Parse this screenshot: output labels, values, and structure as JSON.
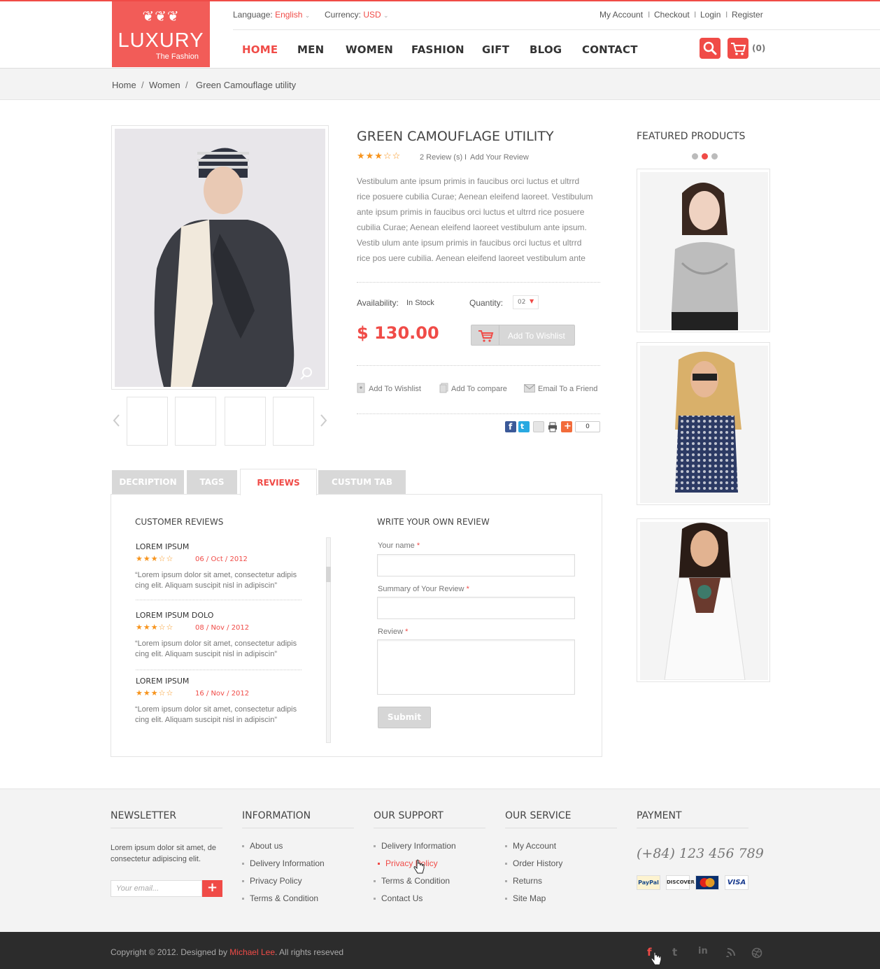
{
  "logo": {
    "brand": "LUXURY",
    "tagline": "The Fashion",
    "ornament": "❦❦❦"
  },
  "topbar": {
    "language_label": "Language:",
    "language_value": "English",
    "currency_label": "Currency:",
    "currency_value": "USD",
    "links": [
      "My Account",
      "Checkout",
      "Login",
      "Register"
    ],
    "separator": "I"
  },
  "nav": [
    "HOME",
    "MEN",
    "WOMEN",
    "FASHION",
    "GIFT",
    "BLOG",
    "CONTACT"
  ],
  "cart_count": "(0)",
  "breadcrumb": {
    "items": [
      "Home",
      "Women"
    ],
    "current": "Green Camouflage utility",
    "separator": "/"
  },
  "product": {
    "title": "GREEN CAMOUFLAGE UTILITY",
    "rating": 3,
    "reviews_text": "2 Review (s)",
    "add_review": "Add Your Review",
    "description": [
      "Vestibulum ante ipsum primis in faucibus orci luctus et ultrrd",
      "rice posuere cubilia Curae; Aenean eleifend laoreet. Vestibulum",
      "ante ipsum primis in faucibus orci luctus et ultrrd rice posuere",
      "cubilia Curae; Aenean eleifend laoreet vestibulum ante ipsum.",
      "Vestib ulum ante ipsum primis in faucibus orci luctus et ultrrd",
      "rice pos uere cubilia. Aenean eleifend laoreet vestibulum ante"
    ],
    "availability_label": "Availability:",
    "availability_value": "In Stock",
    "quantity_label": "Quantity:",
    "quantity_value": "02",
    "price": "$ 130.00",
    "wishlist_button": "Add To Wishlist",
    "actions": [
      "Add To Wishlist",
      "Add To compare",
      "Email To a Friend"
    ],
    "share_count": "0"
  },
  "featured": {
    "title": "FEATURED PRODUCTS",
    "active_dot": 1
  },
  "tabs": [
    "DECRIPTION",
    "TAGS",
    "REVIEWS",
    "CUSTUM TAB"
  ],
  "active_tab": "REVIEWS",
  "reviews": {
    "title": "CUSTOMER REVIEWS",
    "items": [
      {
        "name": "LOREM IPSUM",
        "date": "06 / Oct / 2012",
        "rating": 3,
        "line1": "“Lorem ipsum dolor sit amet, consectetur adipis",
        "line2": "cing elit.  Aliquam suscipit nisl in adipiscin”"
      },
      {
        "name": "LOREM IPSUM DOLO",
        "date": "08 / Nov / 2012",
        "rating": 3,
        "line1": "“Lorem ipsum dolor sit amet, consectetur adipis",
        "line2": "cing elit.  Aliquam suscipit nisl in adipiscin”"
      },
      {
        "name": "LOREM IPSUM",
        "date": "16 / Nov / 2012",
        "rating": 3,
        "line1": "“Lorem ipsum dolor sit amet, consectetur adipis",
        "line2": "cing elit.  Aliquam suscipit nisl in adipiscin”"
      }
    ]
  },
  "review_form": {
    "title": "WRITE YOUR OWN REVIEW",
    "name_label": "Your name",
    "summary_label": "Summary of Your Review",
    "review_label": "Review",
    "required": "*",
    "submit": "Submit"
  },
  "footer": {
    "newsletter": {
      "title": "NEWSLETTER",
      "text": "Lorem ipsum dolor sit amet, de consectetur adipiscing elit.",
      "placeholder": "Your email...",
      "button": "+"
    },
    "information": {
      "title": "INFORMATION",
      "links": [
        "About us",
        "Delivery Information",
        "Privacy Policy",
        "Terms & Condition"
      ]
    },
    "support": {
      "title": "OUR SUPPORT",
      "links": [
        "Delivery Information",
        "Privacy Policy",
        "Terms & Condition",
        "Contact Us"
      ],
      "active": 1
    },
    "service": {
      "title": "OUR SERVICE",
      "links": [
        "My Account",
        "Order History",
        "Returns",
        "Site Map"
      ]
    },
    "payment": {
      "title": "PAYMENT",
      "phone": "(+84) 123 456 789",
      "cards": [
        "PayPal",
        "DISCOVER",
        "MC",
        "VISA"
      ]
    },
    "copyright_prefix": "Copyright © 2012. Designed by",
    "designer": "Michael Lee",
    "copyright_suffix": ". All rights reseved",
    "social": [
      "f",
      "t",
      "in",
      "rss",
      "dribbble"
    ]
  },
  "colors": {
    "accent": "#f04b47",
    "star": "#f7941d",
    "footer_bg": "#f3f3f3",
    "bottom_bar": "#2c2c2c"
  }
}
